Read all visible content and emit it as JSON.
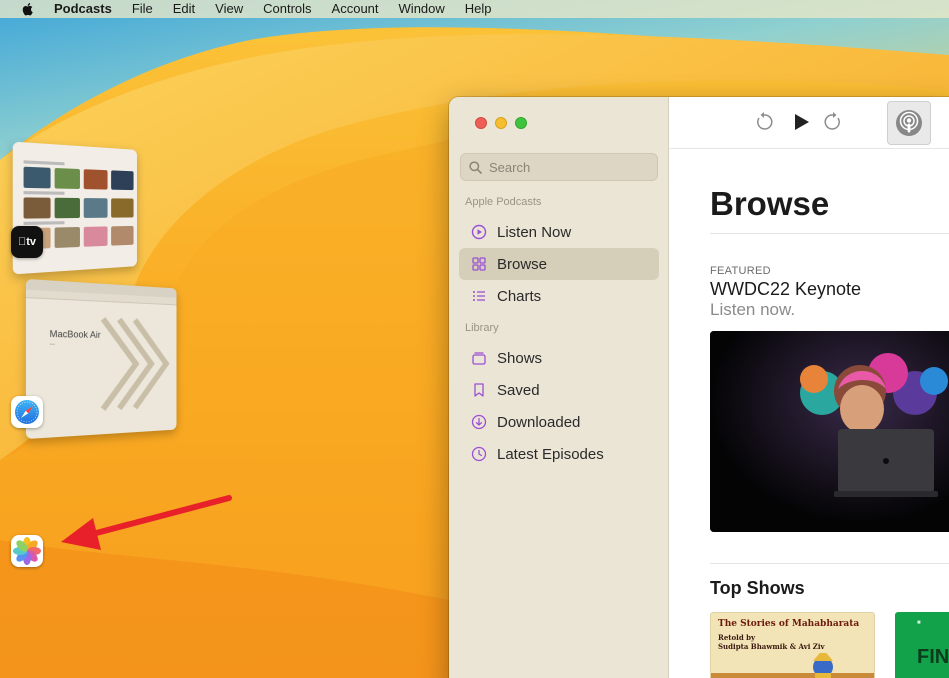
{
  "menubar": {
    "app_name": "Podcasts",
    "items": [
      "File",
      "Edit",
      "View",
      "Controls",
      "Account",
      "Window",
      "Help"
    ]
  },
  "stage_manager": {
    "safari_preview_title": "MacBook Air",
    "tv_badge": "tv",
    "apps": [
      {
        "name": "apple-tv-icon"
      },
      {
        "name": "safari-icon"
      },
      {
        "name": "photos-icon"
      }
    ]
  },
  "window": {
    "traffic_lights": [
      "close",
      "minimize",
      "zoom"
    ],
    "search_placeholder": "Search",
    "sidebar": {
      "section_apple": "Apple Podcasts",
      "section_library": "Library",
      "items": [
        {
          "label": "Listen Now",
          "icon": "play-circle-icon",
          "active": false
        },
        {
          "label": "Browse",
          "icon": "grid-icon",
          "active": true
        },
        {
          "label": "Charts",
          "icon": "list-icon",
          "active": false
        },
        {
          "label": "Shows",
          "icon": "stack-icon",
          "active": false
        },
        {
          "label": "Saved",
          "icon": "bookmark-icon",
          "active": false
        },
        {
          "label": "Downloaded",
          "icon": "download-icon",
          "active": false
        },
        {
          "label": "Latest Episodes",
          "icon": "clock-icon",
          "active": false
        }
      ]
    },
    "main": {
      "title": "Browse",
      "featured_label": "FEATURED",
      "featured_title": "WWDC22 Keynote",
      "featured_subtitle": "Listen now.",
      "top_shows_title": "Top Shows",
      "show_1_title": "The Stories of Mahabharata",
      "show_1_credit_1": "Retold by",
      "show_1_credit_2": "Sudipta Bhawmik & Avi Ziv",
      "show_2_title": "FIN"
    }
  },
  "colors": {
    "accent_purple": "#9b4fd6",
    "sidebar_bg": "#ebe5d6",
    "sidebar_active": "#d5ceb8"
  }
}
